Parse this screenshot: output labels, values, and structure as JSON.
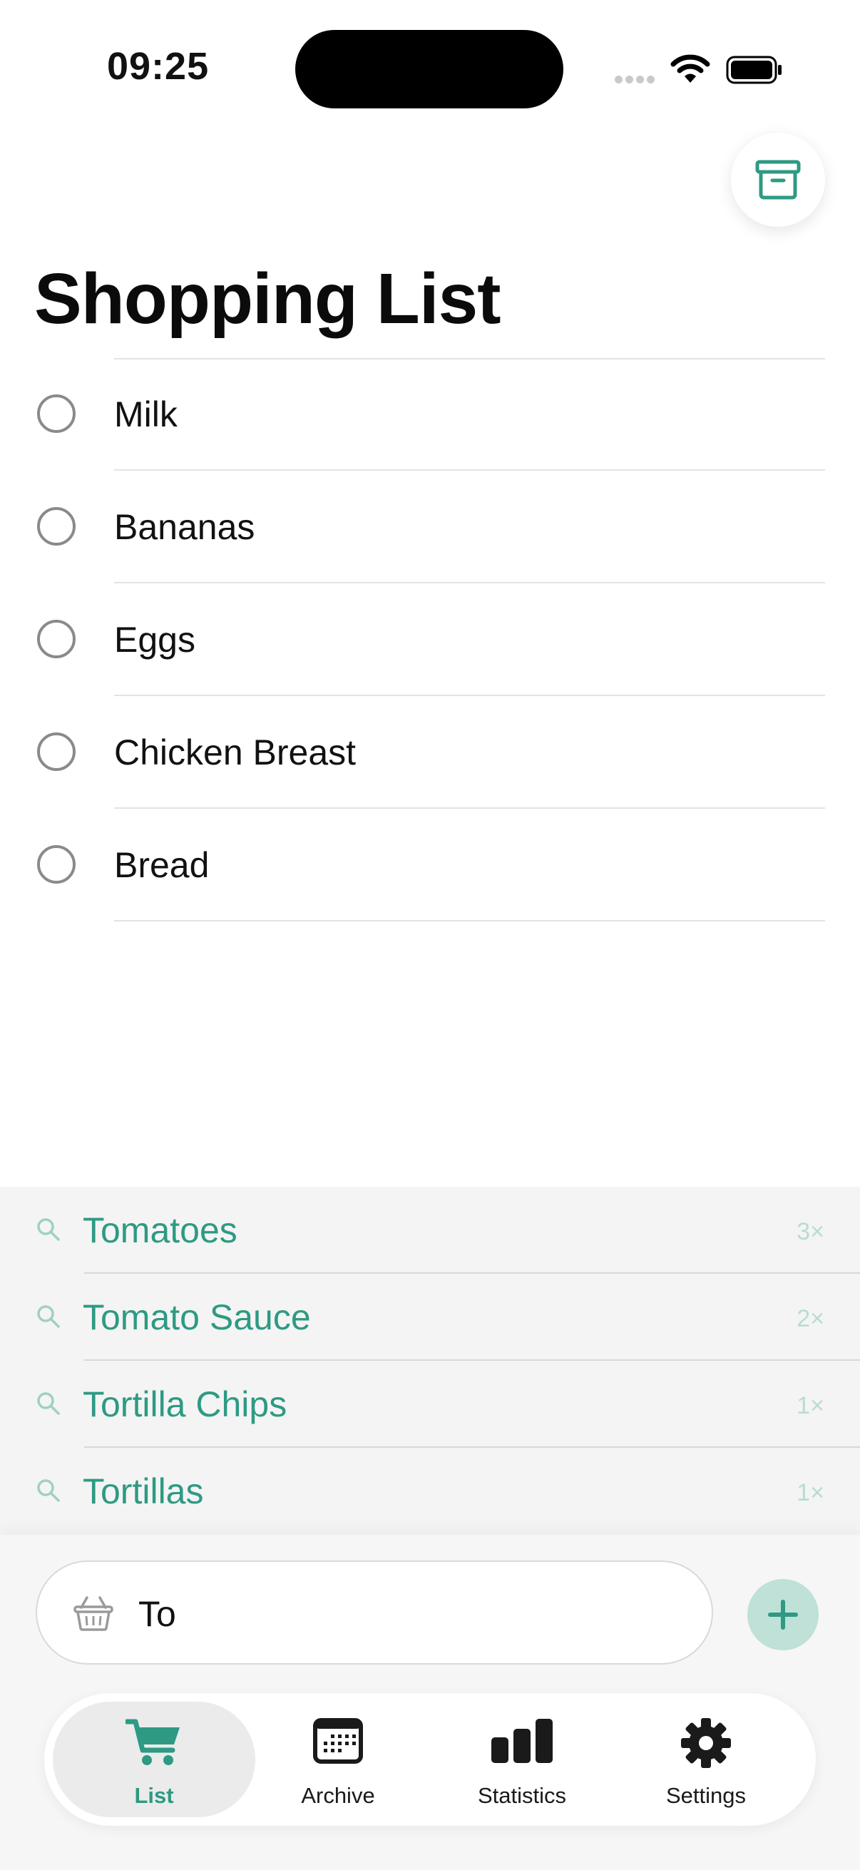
{
  "status_bar": {
    "time": "09:25"
  },
  "header": {
    "title": "Shopping List"
  },
  "list": {
    "items": [
      {
        "label": "Milk",
        "checked": false
      },
      {
        "label": "Bananas",
        "checked": false
      },
      {
        "label": "Eggs",
        "checked": false
      },
      {
        "label": "Chicken Breast",
        "checked": false
      },
      {
        "label": "Bread",
        "checked": false
      }
    ]
  },
  "suggestions": [
    {
      "name": "Tomatoes",
      "count": "3×"
    },
    {
      "name": "Tomato Sauce",
      "count": "2×"
    },
    {
      "name": "Tortilla Chips",
      "count": "1×"
    },
    {
      "name": "Tortillas",
      "count": "1×"
    }
  ],
  "input": {
    "value": "To"
  },
  "tabs": [
    {
      "label": "List",
      "icon": "cart-icon",
      "active": true
    },
    {
      "label": "Archive",
      "icon": "calendar-icon",
      "active": false
    },
    {
      "label": "Statistics",
      "icon": "bar-chart-icon",
      "active": false
    },
    {
      "label": "Settings",
      "icon": "gear-icon",
      "active": false
    }
  ],
  "colors": {
    "accent": "#2e9a83",
    "accent_light": "#bfe1d7",
    "count_text": "#b9dcd2",
    "suggestion_bg": "#f4f4f4"
  }
}
